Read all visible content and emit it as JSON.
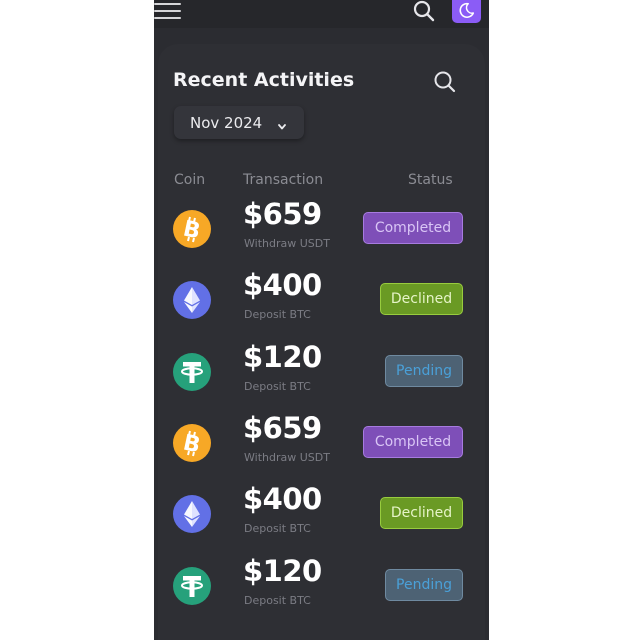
{
  "colors": {
    "screen_bg": "#2b2c31",
    "card_bg": "#2e2f34",
    "accent_purple": "#8b5cf6",
    "completed": "#7e4fb8",
    "declined": "#6a9a24",
    "pending": "#4d6274",
    "bitcoin": "#f7a826",
    "ethereum": "#6270e6",
    "tether": "#26a17b"
  },
  "header": {
    "menu_icon": "hamburger-menu-icon",
    "search_icon": "search-icon",
    "theme_icon": "moon-icon"
  },
  "card": {
    "title": "Recent Activities",
    "search_icon": "search-icon",
    "month_select": {
      "value": "Nov 2024",
      "icon": "chevron-down-icon"
    },
    "columns": [
      "Coin",
      "Transaction",
      "Status"
    ]
  },
  "transactions": [
    {
      "coin": "bitcoin",
      "coin_icon": "bitcoin-icon",
      "amount": "$659",
      "description": "Withdraw USDT",
      "status": "Completed",
      "status_type": "completed"
    },
    {
      "coin": "ethereum",
      "coin_icon": "ethereum-icon",
      "amount": "$400",
      "description": "Deposit BTC",
      "status": "Declined",
      "status_type": "declined"
    },
    {
      "coin": "tether",
      "coin_icon": "tether-icon",
      "amount": "$120",
      "description": "Deposit BTC",
      "status": "Pending",
      "status_type": "pending"
    },
    {
      "coin": "bitcoin",
      "coin_icon": "bitcoin-icon",
      "amount": "$659",
      "description": "Withdraw USDT",
      "status": "Completed",
      "status_type": "completed"
    },
    {
      "coin": "ethereum",
      "coin_icon": "ethereum-icon",
      "amount": "$400",
      "description": "Deposit BTC",
      "status": "Declined",
      "status_type": "declined"
    },
    {
      "coin": "tether",
      "coin_icon": "tether-icon",
      "amount": "$120",
      "description": "Deposit BTC",
      "status": "Pending",
      "status_type": "pending"
    }
  ]
}
